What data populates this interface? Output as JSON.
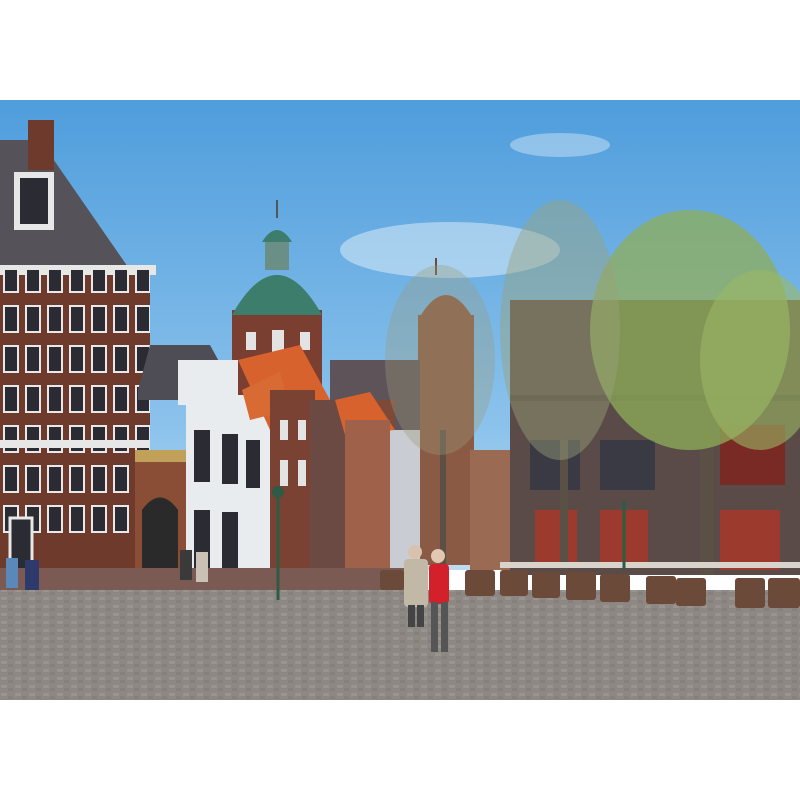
{
  "image": {
    "scene": "town-square-with-church-dome",
    "colors": {
      "sky": "#5aa6e0",
      "sky_light": "#a9d3f2",
      "brick": "#6e3a2c",
      "brick_dark": "#4b2a22",
      "roof_orange": "#d8622d",
      "dome_green": "#3c7d6c",
      "white_facade": "#e9ecef",
      "cobbles": "#8f8a86",
      "tree_green": "#8fae5a",
      "chairs": "#6b4a3a",
      "modern_block": "#5a4b48"
    }
  }
}
